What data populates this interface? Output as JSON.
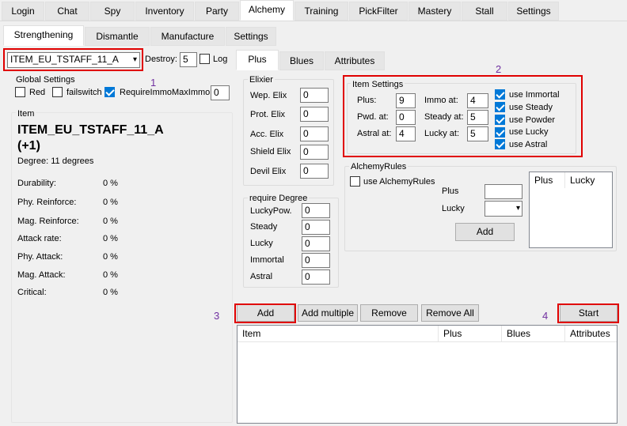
{
  "main_tabs": [
    "Login",
    "Chat",
    "Spy",
    "Inventory",
    "Party",
    "Alchemy",
    "Training",
    "PickFilter",
    "Mastery",
    "Stall",
    "Settings"
  ],
  "sub_tabs": [
    "Strengthening",
    "Dismantle",
    "Manufacture",
    "Settings"
  ],
  "item_select": {
    "value": "ITEM_EU_TSTAFF_11_A",
    "arrow": "▾"
  },
  "destroy": {
    "label": "Destroy:",
    "value": "5"
  },
  "log_label": "Log",
  "global_settings": {
    "title": "Global Settings",
    "red": "Red",
    "failswitch": "failswitch",
    "require_immo": "RequireImmo",
    "max_immo_label": "MaxImmo:",
    "max_immo_value": "0"
  },
  "item_panel": {
    "title": "Item",
    "name_line1": "ITEM_EU_TSTAFF_11_A",
    "name_line2": "(+1)",
    "degree": "Degree: 11 degrees",
    "stats": [
      {
        "label": "Durability:",
        "value": "0 %"
      },
      {
        "label": "Phy. Reinforce:",
        "value": "0 %"
      },
      {
        "label": "Mag. Reinforce:",
        "value": "0 %"
      },
      {
        "label": "Attack rate:",
        "value": "0 %"
      },
      {
        "label": "Phy. Attack:",
        "value": "0 %"
      },
      {
        "label": "Mag. Attack:",
        "value": "0 %"
      },
      {
        "label": "Critical:",
        "value": "0 %"
      }
    ]
  },
  "right_tabs": [
    "Plus",
    "Blues",
    "Attributes"
  ],
  "elixier": {
    "title": "Elixier",
    "rows": [
      {
        "label": "Wep. Elix",
        "value": "0"
      },
      {
        "label": "Prot. Elix",
        "value": "0"
      },
      {
        "label": "Acc. Elix",
        "value": "0"
      },
      {
        "label": "Shield Elix",
        "value": "0"
      },
      {
        "label": "Devil Elix",
        "value": "0"
      }
    ]
  },
  "require_degree": {
    "title": "require Degree",
    "rows": [
      {
        "label": "LuckyPow.",
        "value": "0"
      },
      {
        "label": "Steady",
        "value": "0"
      },
      {
        "label": "Lucky",
        "value": "0"
      },
      {
        "label": "Immortal",
        "value": "0"
      },
      {
        "label": "Astral",
        "value": "0"
      }
    ]
  },
  "item_settings": {
    "title": "Item Settings",
    "plus_label": "Plus:",
    "plus_value": "9",
    "pwd_label": "Pwd. at:",
    "pwd_value": "0",
    "astral_label": "Astral at:",
    "astral_value": "4",
    "immo_label": "Immo at:",
    "immo_value": "4",
    "steady_label": "Steady at:",
    "steady_value": "5",
    "lucky_label": "Lucky at:",
    "lucky_value": "5",
    "checks": [
      "use Immortal",
      "use Steady",
      "use Powder",
      "use Lucky",
      "use Astral"
    ]
  },
  "alchemy_rules": {
    "title": "AlchemyRules",
    "use_label": "use AlchemyRules",
    "plus_label": "Plus",
    "lucky_label": "Lucky",
    "add_label": "Add",
    "table_headers": [
      "Plus",
      "Lucky"
    ]
  },
  "list_buttons": {
    "add": "Add",
    "add_multiple": "Add multiple",
    "remove": "Remove",
    "remove_all": "Remove All",
    "start": "Start"
  },
  "list_headers": [
    "Item",
    "Plus",
    "Blues",
    "Attributes"
  ],
  "annotations": [
    "1",
    "2",
    "3",
    "4"
  ],
  "colors": {
    "highlight": "#e00000",
    "annotation": "#7030a0",
    "check_on": "#0078d7"
  }
}
